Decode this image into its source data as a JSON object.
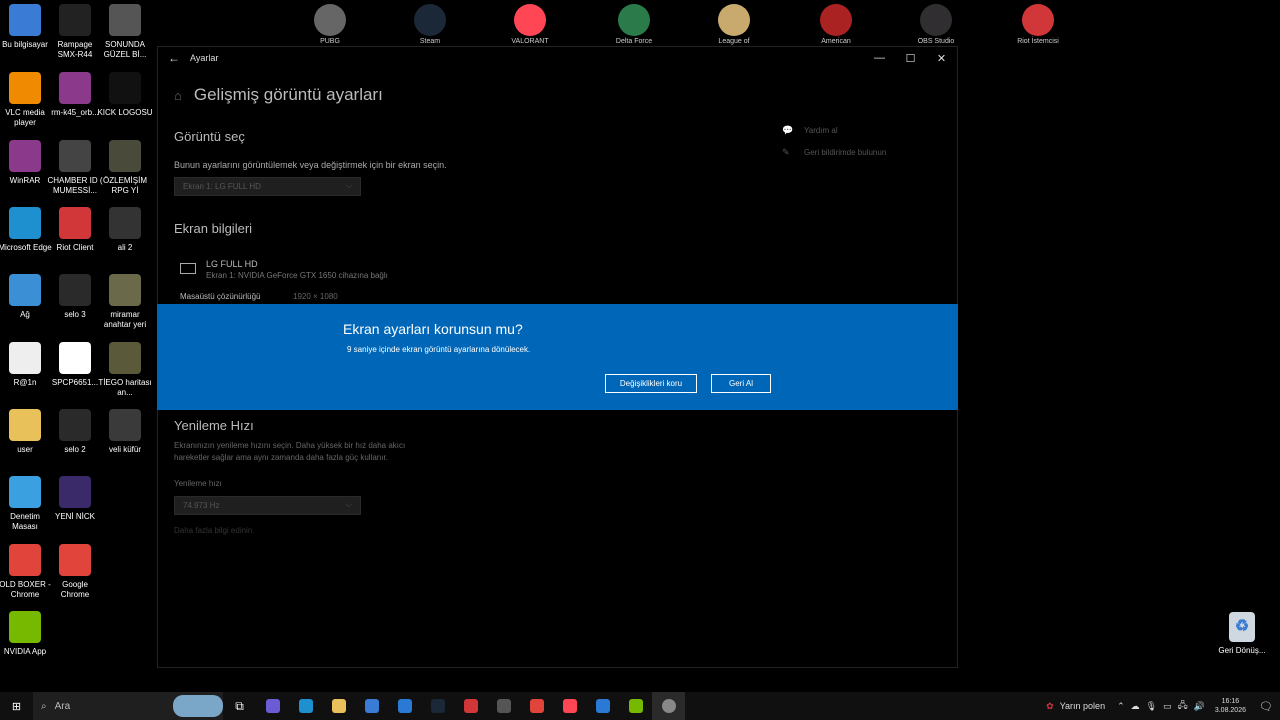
{
  "desktop": {
    "icons": [
      {
        "label": "Bu bilgisayar",
        "icon": "computer-icon",
        "color": "#3a7bd5"
      },
      {
        "label": "Rampage SMX-R44",
        "icon": "mouse-icon",
        "color": "#222222"
      },
      {
        "label": "SONUNDA GÜZEL Bİ...",
        "icon": "image-icon",
        "color": "#555555"
      },
      {
        "label": "VLC media player",
        "icon": "vlc-icon",
        "color": "#f08a00"
      },
      {
        "label": "rm-k45_orb...",
        "icon": "winrar-icon",
        "color": "#8b3a8b"
      },
      {
        "label": "KICK LOGOSU",
        "icon": "image-icon",
        "color": "#111111"
      },
      {
        "label": "WinRAR",
        "icon": "winrar-icon",
        "color": "#8b3a8b"
      },
      {
        "label": "CHAMBER ID ( MUMESSİ...",
        "icon": "image-icon",
        "color": "#444444"
      },
      {
        "label": "ÖZLEMİŞİM RPG Yİ",
        "icon": "image-icon",
        "color": "#4a4a3a"
      },
      {
        "label": "Microsoft Edge",
        "icon": "edge-icon",
        "color": "#1e90d0"
      },
      {
        "label": "Riot Client",
        "icon": "riot-icon",
        "color": "#d13639"
      },
      {
        "label": "ali 2",
        "icon": "image-icon",
        "color": "#333333"
      },
      {
        "label": "Ağ",
        "icon": "network-icon",
        "color": "#3a8fd5"
      },
      {
        "label": "selo 3",
        "icon": "image-icon",
        "color": "#2a2a2a"
      },
      {
        "label": "miramar anahtar yeri",
        "icon": "image-icon",
        "color": "#6a6a4a"
      },
      {
        "label": "R@1n",
        "icon": "document-icon",
        "color": "#eeeeee"
      },
      {
        "label": "SPCP6651...",
        "icon": "document-icon",
        "color": "#ffffff"
      },
      {
        "label": "TİEGO haritası an...",
        "icon": "image-icon",
        "color": "#5a5a3a"
      },
      {
        "label": "user",
        "icon": "folder-icon",
        "color": "#e8c15a"
      },
      {
        "label": "selo 2",
        "icon": "image-icon",
        "color": "#2a2a2a"
      },
      {
        "label": "veli küfür",
        "icon": "image-icon",
        "color": "#3a3a3a"
      },
      {
        "label": "Denetim Masası",
        "icon": "control-panel-icon",
        "color": "#3aa0e0"
      },
      {
        "label": "YENİ NİCK",
        "icon": "image-icon",
        "color": "#3a2a6a"
      },
      {
        "label": "OLD BOXER - Chrome",
        "icon": "chrome-icon",
        "color": "#e0443a"
      },
      {
        "label": "Google Chrome",
        "icon": "chrome-icon",
        "color": "#e0443a"
      },
      {
        "label": "NVIDIA App",
        "icon": "nvidia-icon",
        "color": "#76b900"
      }
    ],
    "top_icons": [
      {
        "label": "PUBG",
        "icon": "pubg-icon",
        "color": "#666666"
      },
      {
        "label": "Steam",
        "icon": "steam-icon",
        "color": "#1b2838"
      },
      {
        "label": "VALORANT",
        "icon": "valorant-icon",
        "color": "#ff4655"
      },
      {
        "label": "Delta Force",
        "icon": "delta-force-icon",
        "color": "#2a7a4a"
      },
      {
        "label": "League of",
        "icon": "lol-icon",
        "color": "#c8aa6e"
      },
      {
        "label": "American",
        "icon": "truck-icon",
        "color": "#aa2222"
      },
      {
        "label": "OBS Studio",
        "icon": "obs-icon",
        "color": "#302e31"
      },
      {
        "label": "Riot İstemcisi",
        "icon": "riot-icon",
        "color": "#d13639"
      }
    ],
    "recycle_bin": "Geri Dönüş..."
  },
  "settings": {
    "window_title": "Ayarlar",
    "page_title": "Gelişmiş görüntü ayarları",
    "select_display": {
      "title": "Görüntü seç",
      "description": "Bunun ayarlarını görüntülemek veya değiştirmek için bir ekran seçin.",
      "value": "Ekran 1: LG FULL HD"
    },
    "display_info": {
      "title": "Ekran bilgileri",
      "monitor_name": "LG FULL HD",
      "monitor_sub": "Ekran 1: NVIDIA GeForce GTX 1650 cihazına bağlı",
      "resolution_label": "Masaüstü çözünürlüğü",
      "resolution_value": "1920 × 1080"
    },
    "refresh": {
      "title": "Yenileme Hızı",
      "description_line1": "Ekranınızın yenileme hızını seçin. Daha yüksek bir hız daha akıcı",
      "description_line2": "hareketler sağlar ama aynı zamanda daha fazla güç kullanır.",
      "label": "Yenileme hızı",
      "value": "74.973 Hz",
      "link": "Daha fazla bilgi edinin"
    },
    "side_links": {
      "help": "Yardım al",
      "feedback": "Geri bildirimde bulunun"
    }
  },
  "dialog": {
    "title": "Ekran ayarları korunsun mu?",
    "message": "9 saniye içinde ekran görüntü ayarlarına dönülecek.",
    "keep_label": "Değişiklikleri koru",
    "revert_label": "Geri Al",
    "bg_color": "#0067b8"
  },
  "taskbar": {
    "search_placeholder": "Ara",
    "weather": "Yarın polen",
    "time": "16:16",
    "date": "3.08.2026",
    "apps": [
      "#6b5cd6",
      "#1e90d0",
      "#e8c15a",
      "#3a7bd5",
      "#2a7ad5",
      "#1b2838",
      "#d13639",
      "#555555",
      "#e0443a",
      "#ff4655",
      "#2a7ad5",
      "#76b900",
      "#888888"
    ]
  }
}
